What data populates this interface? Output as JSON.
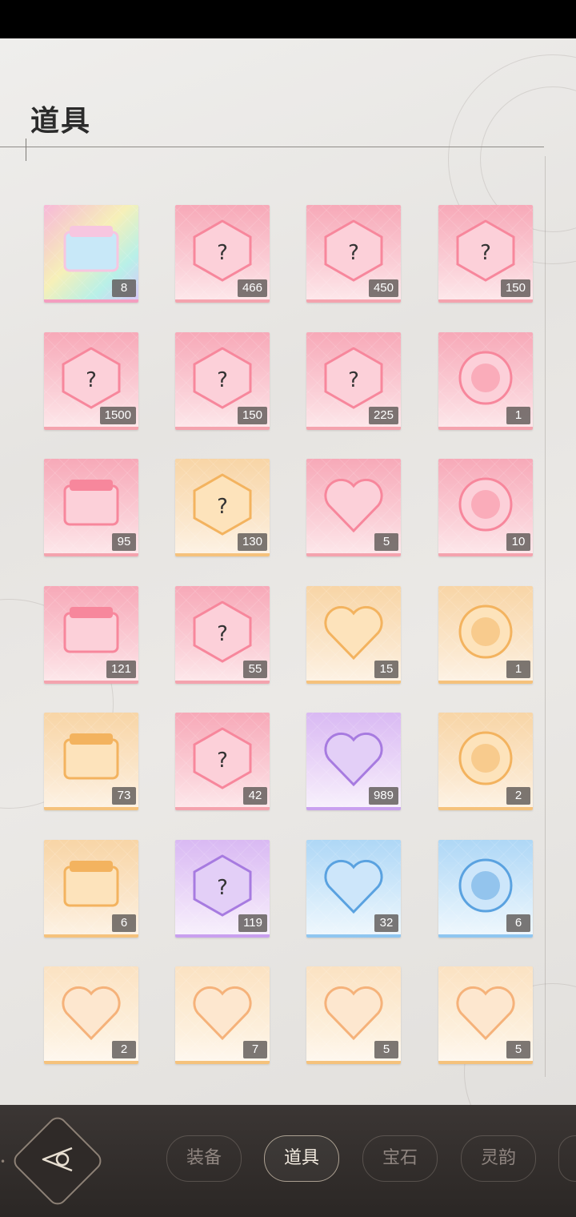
{
  "page": {
    "title": "道具"
  },
  "items": [
    {
      "name": "rainbow-gift-pack",
      "style": "rainbow",
      "count": "8"
    },
    {
      "name": "pink-treasure-chest",
      "style": "pink",
      "count": "466"
    },
    {
      "name": "gold-mystery-box",
      "style": "pink",
      "count": "450"
    },
    {
      "name": "pink-mystery-box",
      "style": "pink",
      "count": "150"
    },
    {
      "name": "blue-mystery-box",
      "style": "pink",
      "count": "1500"
    },
    {
      "name": "green-mystery-box",
      "style": "pink",
      "count": "150"
    },
    {
      "name": "purple-mystery-box",
      "style": "pink",
      "count": "225"
    },
    {
      "name": "pink-card-box",
      "style": "pink",
      "count": "1"
    },
    {
      "name": "pink-mystery-shard",
      "style": "pink",
      "count": "95"
    },
    {
      "name": "gold-mystery-shard",
      "style": "gold",
      "count": "130"
    },
    {
      "name": "heart-key",
      "style": "pink",
      "count": "5"
    },
    {
      "name": "dress-coin",
      "style": "pink",
      "count": "10"
    },
    {
      "name": "fashion-ticket",
      "style": "pink",
      "count": "121"
    },
    {
      "name": "star-photo-ticket",
      "style": "pink",
      "count": "55"
    },
    {
      "name": "cat-card",
      "style": "gold",
      "count": "15"
    },
    {
      "name": "crystal-orb",
      "style": "gold",
      "count": "1"
    },
    {
      "name": "gold-photo-ticket",
      "style": "gold",
      "count": "73"
    },
    {
      "name": "blue-crystal",
      "style": "pink",
      "count": "42"
    },
    {
      "name": "flower-coin",
      "style": "purple",
      "count": "989"
    },
    {
      "name": "energy-drink-can",
      "style": "gold",
      "count": "2"
    },
    {
      "name": "gift-card",
      "style": "gold",
      "count": "6"
    },
    {
      "name": "purple-photo-card",
      "style": "purple",
      "count": "119"
    },
    {
      "name": "pet-food-can",
      "style": "blue",
      "count": "32"
    },
    {
      "name": "ice-crystals",
      "style": "blue",
      "count": "6"
    },
    {
      "name": "heart-frame-green-spirit",
      "style": "heart",
      "count": "2"
    },
    {
      "name": "heart-frame-pink-spirit",
      "style": "heart",
      "count": "7"
    },
    {
      "name": "heart-frame-raccoon",
      "style": "heart",
      "count": "5"
    },
    {
      "name": "heart-frame-fox",
      "style": "heart",
      "count": "5"
    }
  ],
  "bottom_nav": {
    "tabs": [
      "装备",
      "道具",
      "宝石",
      "灵韵"
    ],
    "active": "道具"
  }
}
